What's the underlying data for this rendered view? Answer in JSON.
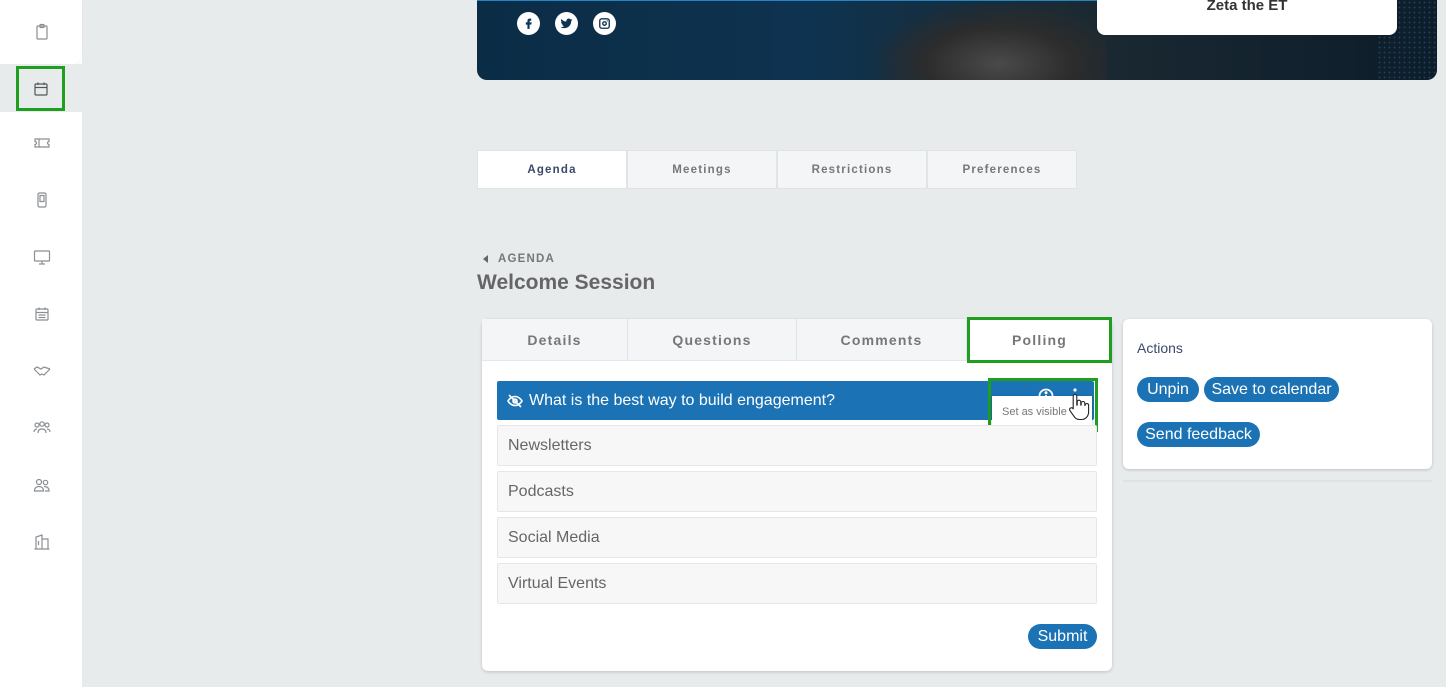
{
  "sidebar": {
    "items": [
      {
        "name": "clipboard-icon"
      },
      {
        "name": "calendar-icon",
        "active": true
      },
      {
        "name": "ticket-icon"
      },
      {
        "name": "mobile-icon"
      },
      {
        "name": "monitor-icon"
      },
      {
        "name": "schedule-icon"
      },
      {
        "name": "handshake-icon"
      },
      {
        "name": "group-icon"
      },
      {
        "name": "users-icon"
      },
      {
        "name": "building-icon"
      }
    ]
  },
  "banner": {
    "speaker_name": "Zeta the ET",
    "social": [
      "facebook-icon",
      "twitter-icon",
      "instagram-icon"
    ]
  },
  "top_tabs": [
    {
      "label": "Agenda",
      "active": true
    },
    {
      "label": "Meetings"
    },
    {
      "label": "Restrictions"
    },
    {
      "label": "Preferences"
    }
  ],
  "breadcrumb": {
    "label": "AGENDA"
  },
  "page_title": "Welcome Session",
  "panel_tabs": [
    {
      "label": "Details"
    },
    {
      "label": "Questions"
    },
    {
      "label": "Comments"
    },
    {
      "label": "Polling",
      "active": true
    }
  ],
  "poll": {
    "question": "What is the best way to build engagement?",
    "tooltip": "Set as visible",
    "options": [
      "Newsletters",
      "Podcasts",
      "Social Media",
      "Virtual Events"
    ],
    "submit_label": "Submit"
  },
  "actions": {
    "title": "Actions",
    "buttons": [
      "Unpin",
      "Save to calendar",
      "Send feedback"
    ]
  },
  "colors": {
    "accent": "#1b73b5",
    "highlight": "#1f9e1f"
  }
}
